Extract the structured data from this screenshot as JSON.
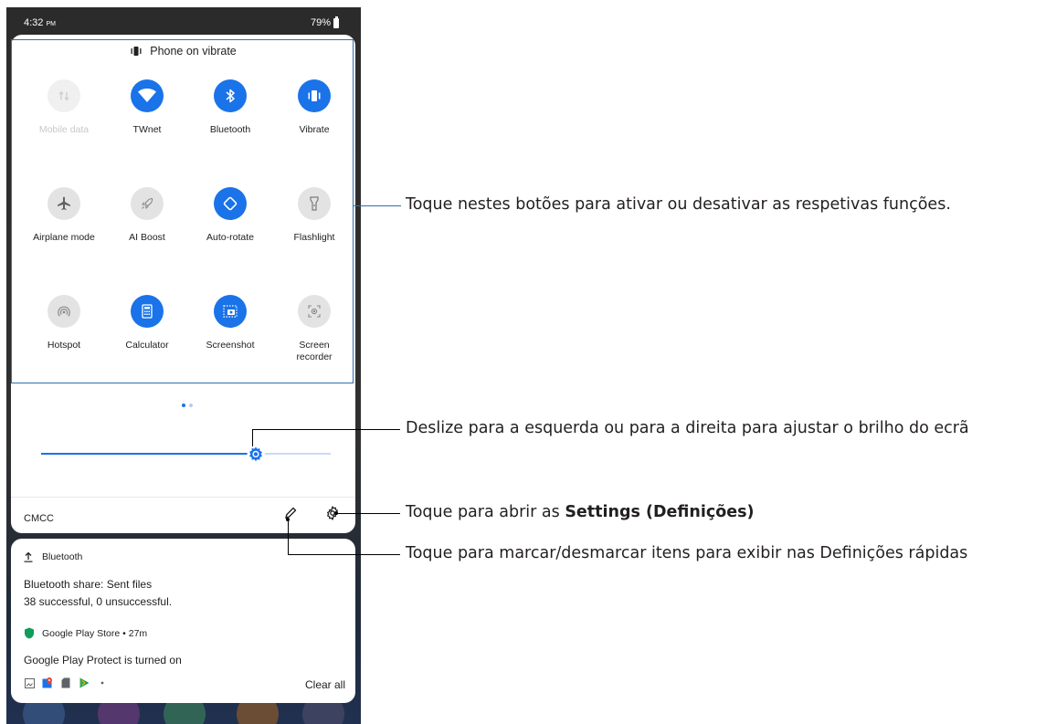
{
  "status_bar": {
    "time": "4:32",
    "ampm": "PM",
    "battery": "79%"
  },
  "qs_header": {
    "text": "Phone on vibrate"
  },
  "tiles": [
    {
      "label": "Mobile data",
      "state": "disabled",
      "icon": "mobile-data-icon"
    },
    {
      "label": "TWnet",
      "state": "on",
      "icon": "wifi-icon"
    },
    {
      "label": "Bluetooth",
      "state": "on",
      "icon": "bluetooth-icon"
    },
    {
      "label": "Vibrate",
      "state": "on",
      "icon": "vibrate-icon"
    },
    {
      "label": "Airplane mode",
      "state": "off",
      "icon": "airplane-icon"
    },
    {
      "label": "AI Boost",
      "state": "off",
      "icon": "rocket-icon"
    },
    {
      "label": "Auto-rotate",
      "state": "on",
      "icon": "auto-rotate-icon"
    },
    {
      "label": "Flashlight",
      "state": "off",
      "icon": "flashlight-icon"
    },
    {
      "label": "Hotspot",
      "state": "off",
      "icon": "hotspot-icon"
    },
    {
      "label": "Calculator",
      "state": "on",
      "icon": "calculator-icon"
    },
    {
      "label": "Screenshot",
      "state": "on",
      "icon": "screenshot-icon"
    },
    {
      "label": "Screen\nrecorder",
      "state": "off",
      "icon": "screen-recorder-icon"
    }
  ],
  "brightness": {
    "level": 0.76
  },
  "footer": {
    "carrier": "CMCC"
  },
  "notifications": {
    "bluetooth": {
      "app": "Bluetooth",
      "title": "Bluetooth share: Sent files",
      "body": "38 successful, 0 unsuccessful."
    },
    "play": {
      "app": "Google Play Store • 27m",
      "title": "Google Play Protect is turned on"
    },
    "clear_all": "Clear all"
  },
  "annotations": {
    "tiles": "Toque nestes botões para ativar ou desativar as respetivas funções.",
    "brightness": "Deslize para a esquerda ou para a direita para ajustar o brilho do ecrã",
    "settings_prefix": "Toque para abrir as ",
    "settings_bold": "Settings (Definições)",
    "edit": "Toque para marcar/desmarcar itens para exibir nas Definições rápidas"
  },
  "colors": {
    "accent": "#1a73e8",
    "tile_off": "#e3e3e3",
    "annotation_box": "#2f6fb0"
  }
}
